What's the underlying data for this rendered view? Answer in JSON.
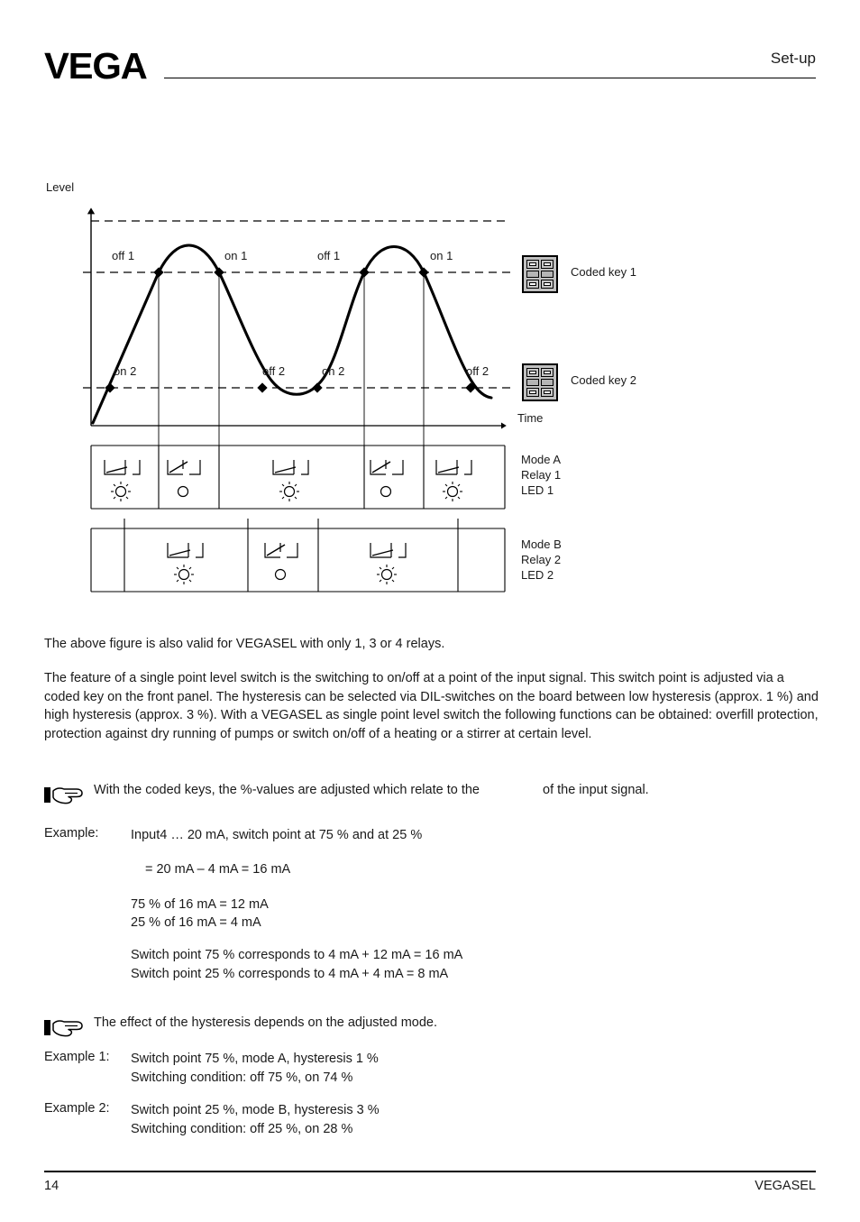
{
  "header": {
    "logo": "VEGA",
    "title": "Set-up"
  },
  "figure": {
    "y_axis_label": "Level",
    "x_axis_label": "Time",
    "curve_labels": [
      {
        "text": "off 1"
      },
      {
        "text": "on 1"
      },
      {
        "text": "off 1"
      },
      {
        "text": "on 1"
      },
      {
        "text": "on 2"
      },
      {
        "text": "off 2"
      },
      {
        "text": "on 2"
      },
      {
        "text": "off 2"
      }
    ],
    "coded_key_1": "Coded key 1",
    "coded_key_2": "Coded key 2",
    "mode_a": "Mode A\nRelay 1\nLED 1",
    "mode_a_line1": "Mode A",
    "mode_a_line2": "Relay 1",
    "mode_a_line3": "LED 1",
    "mode_b_line1": "Mode B",
    "mode_b_line2": "Relay 2",
    "mode_b_line3": "LED 2"
  },
  "chart_data": {
    "type": "line",
    "title": "",
    "xlabel": "Time",
    "ylabel": "Level",
    "grid": true,
    "legend": "none",
    "gridlines_y": [
      100,
      75,
      25
    ],
    "switch_point_1_percent": 75,
    "switch_point_2_percent": 25,
    "description": "Sinusoidal level signal over time crossing two switch thresholds, with relay/LED state rows beneath",
    "markers": [
      {
        "label": "on 2",
        "threshold": 25,
        "direction": "rising"
      },
      {
        "label": "off 1",
        "threshold": 75,
        "direction": "rising"
      },
      {
        "label": "on 1",
        "threshold": 75,
        "direction": "falling"
      },
      {
        "label": "off 2",
        "threshold": 25,
        "direction": "falling"
      },
      {
        "label": "on 2",
        "threshold": 25,
        "direction": "rising"
      },
      {
        "label": "off 1",
        "threshold": 75,
        "direction": "rising"
      },
      {
        "label": "on 1",
        "threshold": 75,
        "direction": "falling"
      },
      {
        "label": "off 2",
        "threshold": 25,
        "direction": "falling"
      }
    ],
    "mode_a_states": [
      "closed",
      "open",
      "closed",
      "open",
      "closed"
    ],
    "mode_b_states": [
      "closed",
      "open",
      "closed"
    ]
  },
  "content": {
    "para1": "The above figure is also valid for VEGASEL with only 1, 3 or 4 relays.",
    "para2": "The feature of a single point level switch is the switching to on/off at a point of the input signal. This switch point is adjusted via a coded key on the front panel. The hysteresis can be selected via DIL-switches on the board between low hysteresis (approx. 1 %) and high hysteresis (approx. 3 %). With a VEGASEL as single point level switch the following functions can be obtained: overfill protection, protection against dry running of pumps or switch on/off of a heating or a stirrer at certain level.",
    "note1_part1": "With the coded keys, the %-values are adjusted which relate to the",
    "note1_part2": "of the input signal.",
    "note2": "The effect of the hysteresis depends on the adjusted mode.",
    "example_label": "Example:",
    "example_line1": "Input4 … 20 mA, switch point at 75 % and at 25 %",
    "example_line2": "= 20 mA – 4 mA = 16 mA",
    "example_line3": "75 % of 16 mA = 12 mA",
    "example_line4": "25 % of 16 mA = 4 mA",
    "example_line5": "Switch point 75 % corresponds to 4 mA + 12 mA = 16 mA",
    "example_line6": "Switch point 25 % corresponds to 4 mA + 4 mA = 8 mA",
    "example1_label": "Example 1:",
    "example1_line1": "Switch point 75 %, mode A, hysteresis 1 %",
    "example1_line2": "Switching condition: off 75 %, on 74 %",
    "example2_label": "Example 2:",
    "example2_line1": "Switch point 25 %, mode B, hysteresis 3 %",
    "example2_line2": "Switching condition: off 25 %, on 28 %"
  },
  "footer": {
    "page_number": "14",
    "product": "VEGASEL"
  }
}
